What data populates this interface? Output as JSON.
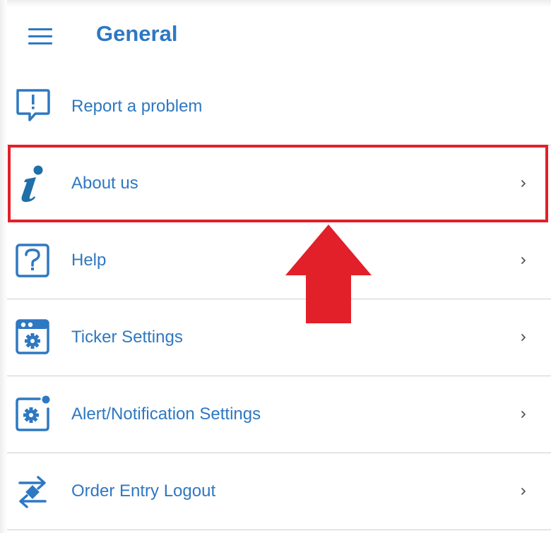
{
  "header": {
    "title": "General"
  },
  "menu": {
    "items": [
      {
        "label": "Report a problem",
        "icon": "report-problem-icon",
        "has_chevron": false
      },
      {
        "label": "About us",
        "icon": "info-icon",
        "has_chevron": true
      },
      {
        "label": "Help",
        "icon": "help-icon",
        "has_chevron": true
      },
      {
        "label": "Ticker Settings",
        "icon": "ticker-settings-icon",
        "has_chevron": true
      },
      {
        "label": "Alert/Notification Settings",
        "icon": "alert-settings-icon",
        "has_chevron": true
      },
      {
        "label": "Order Entry Logout",
        "icon": "order-entry-logout-icon",
        "has_chevron": true
      }
    ]
  },
  "colors": {
    "accent": "#2e78c2",
    "info_icon": "#1f6fa8",
    "annotation_red": "#e2202a",
    "divider": "#cfcfcf",
    "chevron": "#555555"
  },
  "annotation": {
    "highlighted_item": "About us"
  }
}
